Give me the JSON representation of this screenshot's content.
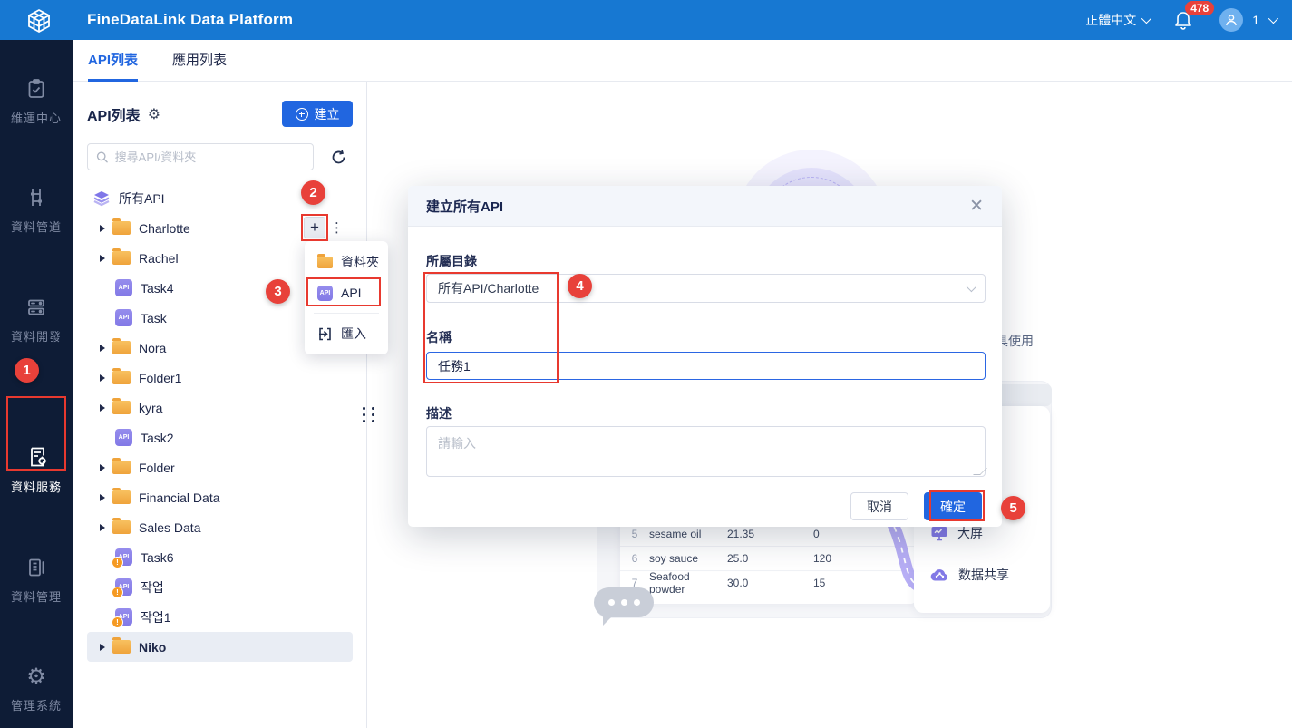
{
  "header": {
    "title": "FineDataLink Data Platform",
    "language": "正體中文",
    "notification_count": "478",
    "user_id": "1"
  },
  "sidebar": {
    "items": [
      {
        "label": "維運中心",
        "icon": "clipboard-check-icon",
        "active": false
      },
      {
        "label": "資料管道",
        "icon": "pipeline-icon",
        "active": false
      },
      {
        "label": "資料開發",
        "icon": "data-dev-icon",
        "active": false
      },
      {
        "label": "資料服務",
        "icon": "data-service-icon",
        "active": true
      },
      {
        "label": "資料管理",
        "icon": "data-manage-icon",
        "active": false
      },
      {
        "label": "管理系統",
        "icon": "gear-icon",
        "active": false
      }
    ]
  },
  "tabs": [
    {
      "label": "API列表",
      "active": true
    },
    {
      "label": "應用列表",
      "active": false
    }
  ],
  "panel": {
    "title": "API列表",
    "create_label": "建立",
    "search_placeholder": "搜尋API/資料夾"
  },
  "tree": {
    "items": [
      {
        "label": "所有API",
        "type": "root"
      },
      {
        "label": "Charlotte",
        "type": "folder"
      },
      {
        "label": "Rachel",
        "type": "folder"
      },
      {
        "label": "Task4",
        "type": "api"
      },
      {
        "label": "Task",
        "type": "api"
      },
      {
        "label": "Nora",
        "type": "folder"
      },
      {
        "label": "Folder1",
        "type": "folder"
      },
      {
        "label": "kyra",
        "type": "folder"
      },
      {
        "label": "Task2",
        "type": "api"
      },
      {
        "label": "Folder",
        "type": "folder"
      },
      {
        "label": "Financial Data",
        "type": "folder"
      },
      {
        "label": "Sales Data",
        "type": "folder"
      },
      {
        "label": "Task6",
        "type": "api-warning"
      },
      {
        "label": "작업",
        "type": "api-warning"
      },
      {
        "label": "작업1",
        "type": "api-warning"
      },
      {
        "label": "Niko",
        "type": "folder",
        "selected": true
      }
    ],
    "api_badge_text": "API"
  },
  "context_menu": {
    "items": [
      {
        "label": "資料夾",
        "icon": "folder-icon"
      },
      {
        "label": "API",
        "icon": "api-icon",
        "highlighted": true
      },
      {
        "label": "匯入",
        "icon": "import-icon"
      }
    ]
  },
  "modal": {
    "title": "建立所有API",
    "directory_label": "所屬目錄",
    "directory_value": "所有API/Charlotte",
    "name_label": "名稱",
    "name_value": "任務1",
    "desc_label": "描述",
    "desc_placeholder": "請輸入",
    "cancel_label": "取消",
    "confirm_label": "確定"
  },
  "background": {
    "partial_text": "具使用",
    "table": {
      "rows": [
        [
          "5",
          "sesame oil",
          "21.35",
          "0"
        ],
        [
          "6",
          "soy sauce",
          "25.0",
          "120"
        ],
        [
          "7",
          "Seafood powder",
          "30.0",
          "15"
        ]
      ]
    },
    "shortcuts": [
      {
        "label": "大屏",
        "icon": "screen-icon"
      },
      {
        "label": "数据共享",
        "icon": "cloud-share-icon"
      }
    ]
  },
  "annotations": {
    "steps": [
      "1",
      "2",
      "3",
      "4",
      "5"
    ]
  },
  "colors": {
    "header_blue": "#1778d2",
    "sidebar_bg": "#0e1c36",
    "accent_blue": "#2166e0",
    "annotation_red": "#e8413a",
    "folder_orange": "#f0a23e",
    "api_purple": "#8279e6"
  }
}
